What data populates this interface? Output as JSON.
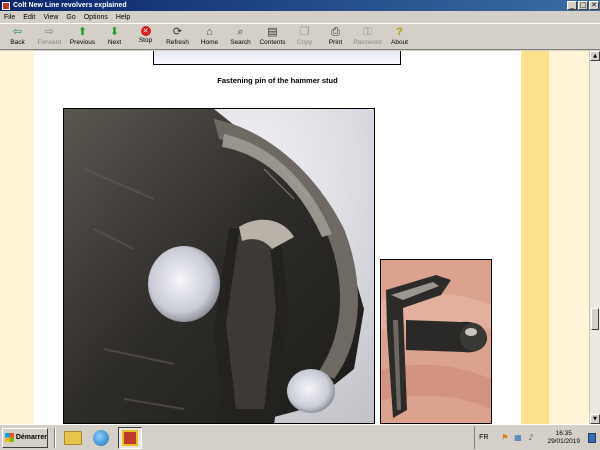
{
  "window": {
    "title": "Colt New Line revolvers explained",
    "controls": {
      "minimize": "_",
      "maximize": "□",
      "close": "✕"
    }
  },
  "menu": [
    "File",
    "Edit",
    "View",
    "Go",
    "Options",
    "Help"
  ],
  "toolbar": {
    "back": "Back",
    "forward": "Forward",
    "previous": "Previous",
    "next": "Next",
    "stop": "Stop",
    "refresh": "Refresh",
    "home": "Home",
    "search": "Search",
    "contents": "Contents",
    "copy": "Copy",
    "print": "Print",
    "password": "Password",
    "about": "About"
  },
  "page": {
    "caption": "Fastening pin of the hammer stud"
  },
  "taskbar": {
    "start_label": "Démarrer",
    "language": "FR",
    "time": "16:35",
    "date": "29/01/2019"
  },
  "colors": {
    "page_bg": "#fff5d6",
    "right_band": "#fde08a"
  }
}
